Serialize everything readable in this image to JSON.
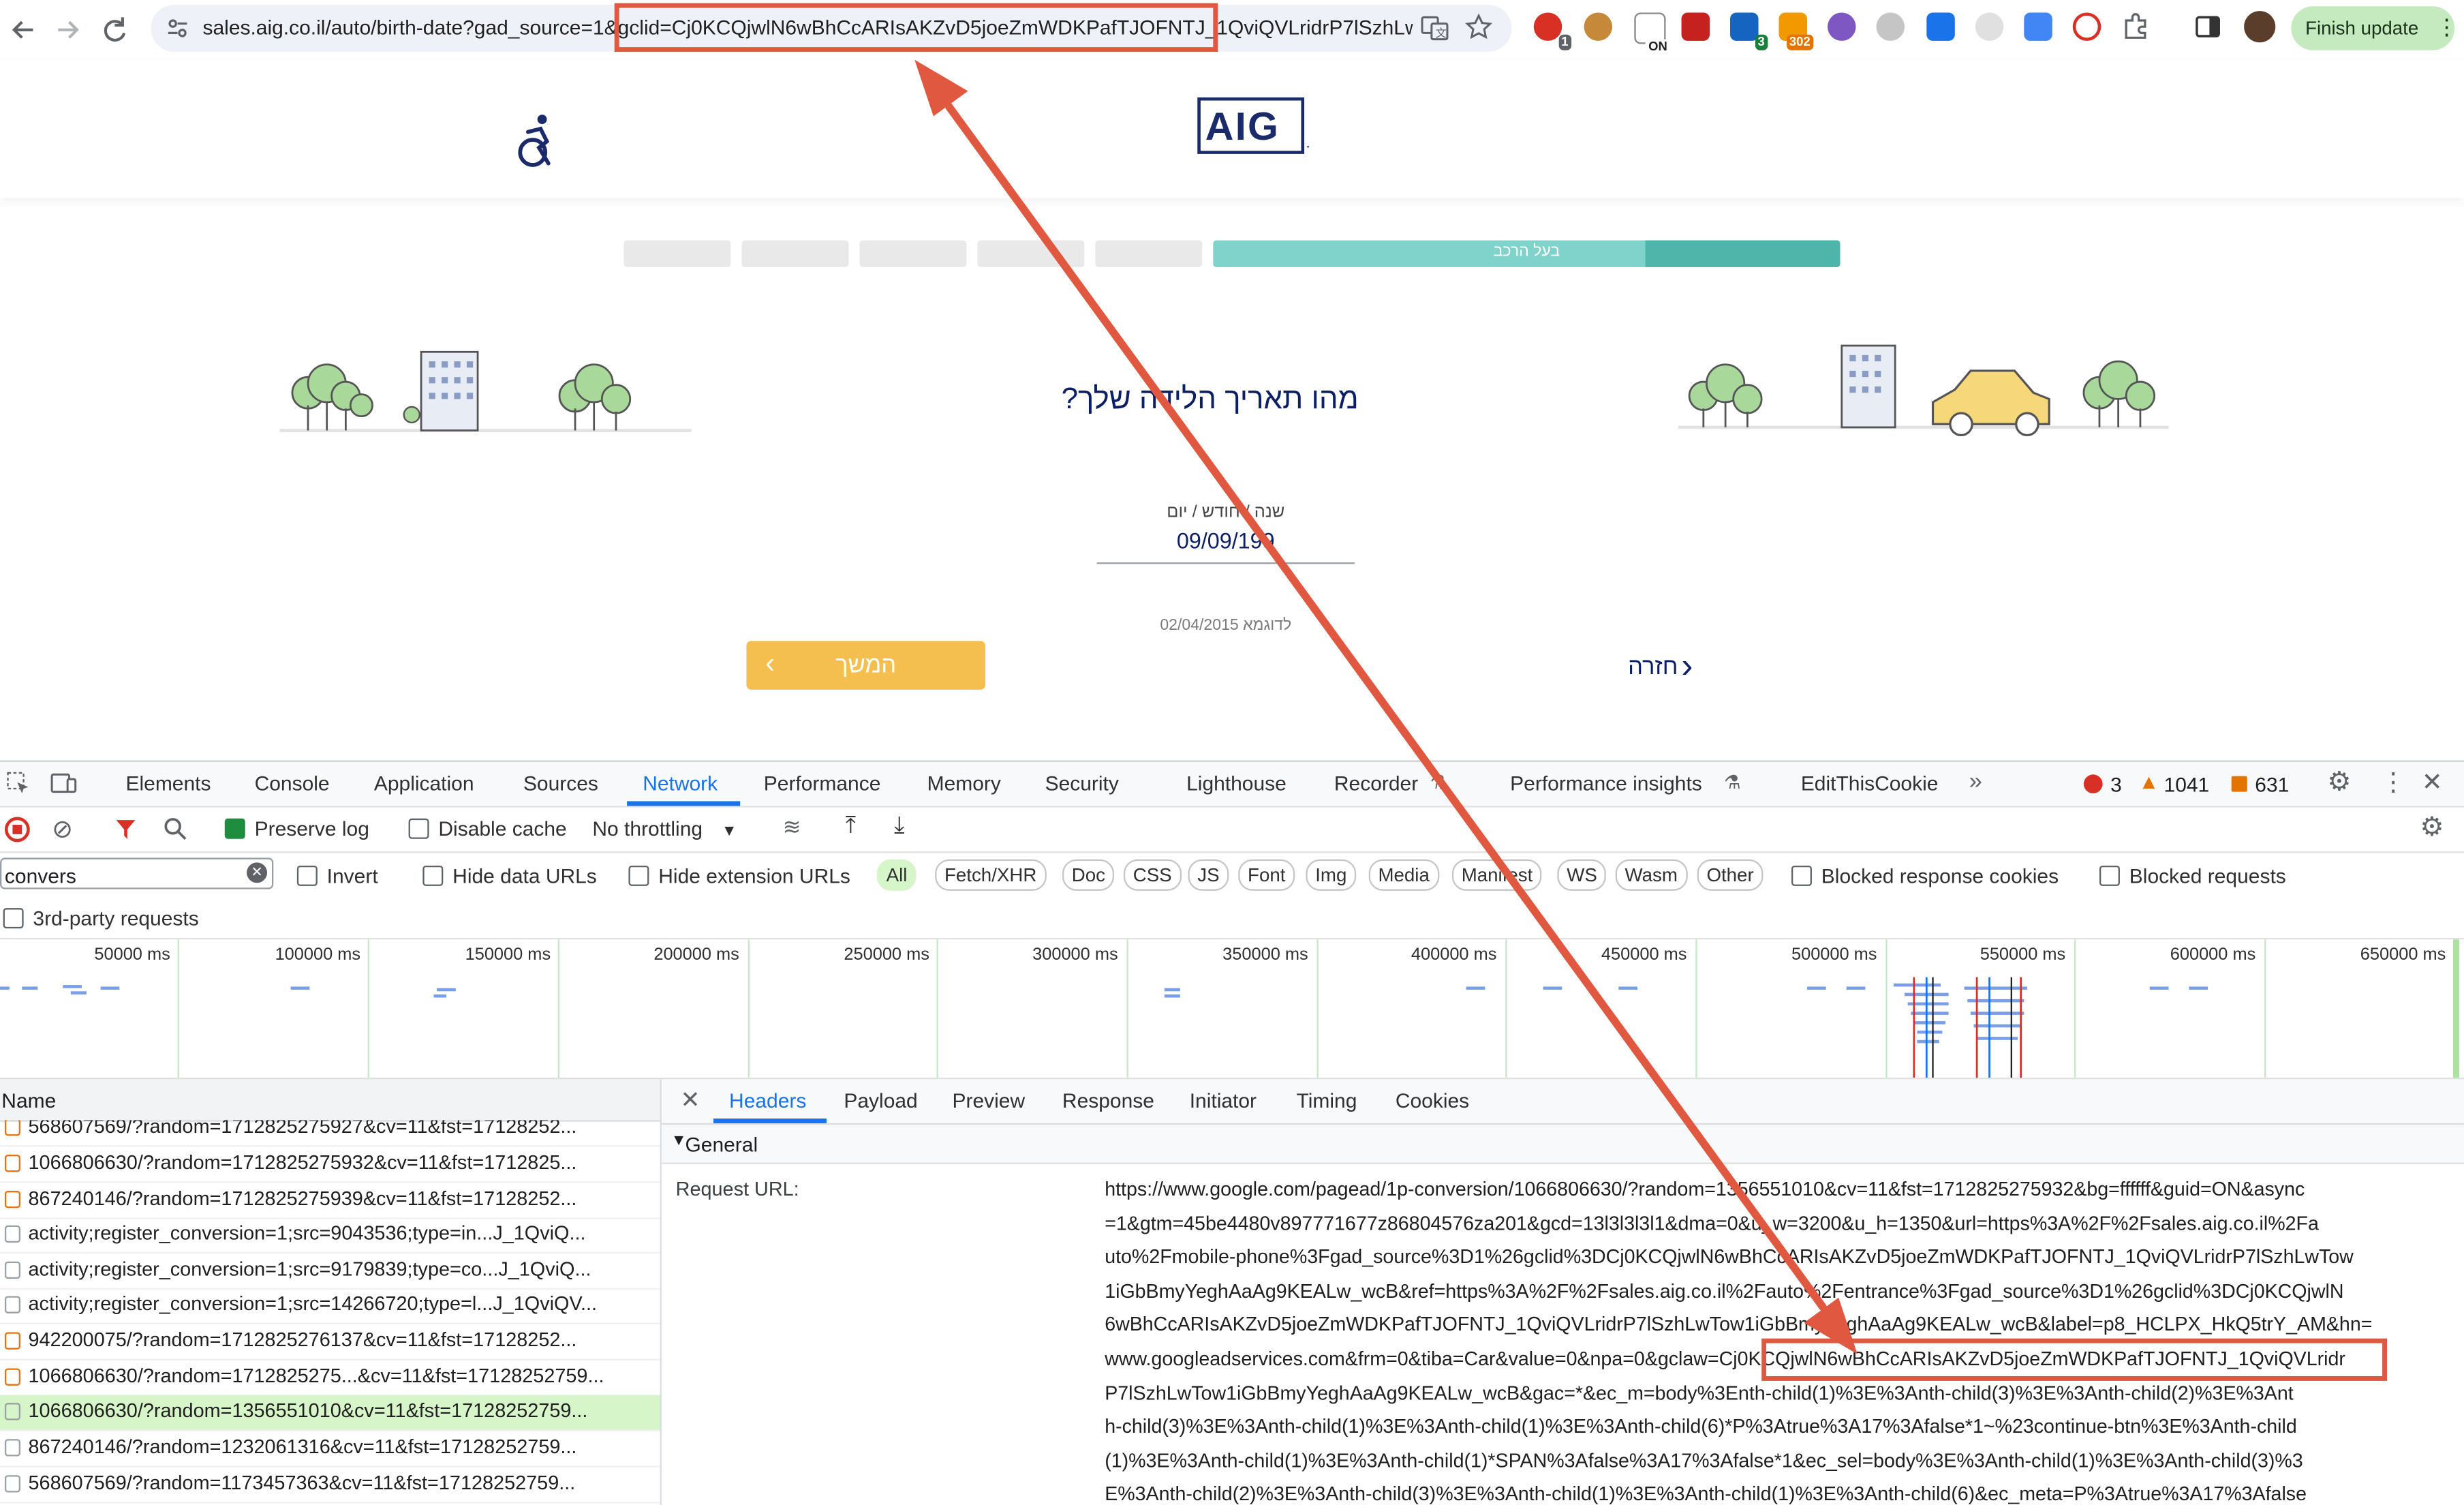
{
  "browser": {
    "url": "sales.aig.co.il/auto/birth-date?gad_source=1&gclid=Cj0KCQjwlN6wBhCcARIsAKZvD5joeZmWDKPafTJOFNTJ_1QviQVLridrP7lSzhLwT...",
    "finish_update_label": "Finish update",
    "ext_badges": [
      "1",
      "ON",
      "3",
      "302"
    ]
  },
  "page": {
    "logo_text": "AIG",
    "logo_mark": ".",
    "progress_label": "בעל הרכב",
    "question": "מהו תאריך הלידה שלך?",
    "field_label": "שנה / חודש / יום",
    "date_value": "09/09/199",
    "example": "לדוגמא 02/04/2015",
    "continue_label": "המשך",
    "back_label": "חזרה"
  },
  "devtools": {
    "tabs": [
      "Elements",
      "Console",
      "Application",
      "Sources",
      "Network",
      "Performance",
      "Memory",
      "Security",
      "Lighthouse",
      "Recorder",
      "Performance insights",
      "EditThisCookie"
    ],
    "active_tab": "Network",
    "errors": "3",
    "warnings": "1041",
    "issues": "631",
    "toolbar": {
      "preserve_log": "Preserve log",
      "disable_cache": "Disable cache",
      "throttling": "No throttling"
    },
    "filter": {
      "value": "convers",
      "invert": "Invert",
      "hide_data_urls": "Hide data URLs",
      "hide_extension_urls": "Hide extension URLs",
      "types": [
        "All",
        "Fetch/XHR",
        "Doc",
        "CSS",
        "JS",
        "Font",
        "Img",
        "Media",
        "Manifest",
        "WS",
        "Wasm",
        "Other"
      ],
      "blocked_cookies": "Blocked response cookies",
      "blocked_requests": "Blocked requests",
      "third_party": "3rd-party requests"
    },
    "timeline_ticks": [
      "50000 ms",
      "100000 ms",
      "150000 ms",
      "200000 ms",
      "250000 ms",
      "300000 ms",
      "350000 ms",
      "400000 ms",
      "450000 ms",
      "500000 ms",
      "550000 ms",
      "600000 ms",
      "650000 ms"
    ],
    "name_header": "Name",
    "requests": [
      {
        "name": "568607569/?random=1712825275927&cv=11&fst=17128252...",
        "type": "script"
      },
      {
        "name": "1066806630/?random=1712825275932&cv=11&fst=1712825...",
        "type": "script"
      },
      {
        "name": "867240146/?random=1712825275939&cv=11&fst=17128252...",
        "type": "script"
      },
      {
        "name": "activity;register_conversion=1;src=9043536;type=in...J_1QviQ...",
        "type": "doc"
      },
      {
        "name": "activity;register_conversion=1;src=9179839;type=co...J_1QviQ...",
        "type": "doc"
      },
      {
        "name": "activity;register_conversion=1;src=14266720;type=l...J_1QviQV...",
        "type": "doc"
      },
      {
        "name": "942200075/?random=1712825276137&cv=11&fst=17128252...",
        "type": "script"
      },
      {
        "name": "1066806630/?random=1712825275...&cv=11&fst=17128252759...",
        "type": "script"
      },
      {
        "name": "1066806630/?random=1356551010&cv=11&fst=17128252759...",
        "type": "doc",
        "selected": true
      },
      {
        "name": "867240146/?random=1232061316&cv=11&fst=17128252759...",
        "type": "doc"
      },
      {
        "name": "568607569/?random=1173457363&cv=11&fst=17128252759...",
        "type": "doc"
      }
    ],
    "detail_tabs": [
      "Headers",
      "Payload",
      "Preview",
      "Response",
      "Initiator",
      "Timing",
      "Cookies"
    ],
    "active_detail_tab": "Headers",
    "general_label": "General",
    "request_url_label": "Request URL:",
    "request_url_lines": [
      "https://www.google.com/pagead/1p-conversion/1066806630/?random=1356551010&cv=11&fst=1712825275932&bg=ffffff&guid=ON&async",
      "=1&gtm=45be4480v897771677z86804576za201&gcd=13l3l3l3l1&dma=0&u_w=3200&u_h=1350&url=https%3A%2F%2Fsales.aig.co.il%2Fa",
      "uto%2Fmobile-phone%3Fgad_source%3D1%26gclid%3DCj0KCQjwlN6wBhCcARIsAKZvD5joeZmWDKPafTJOFNTJ_1QviQVLridrP7lSzhLwTow",
      "1iGbBmyYeghAaAg9KEALw_wcB&ref=https%3A%2F%2Fsales.aig.co.il%2Fauto%2Fentrance%3Fgad_source%3D1%26gclid%3DCj0KCQjwlN",
      "6wBhCcARIsAKZvD5joeZmWDKPafTJOFNTJ_1QviQVLridrP7lSzhLwTow1iGbBmyYeghAaAg9KEALw_wcB&label=p8_HCLPX_HkQ5trY_AM&hn=",
      "www.googleadservices.com&frm=0&tiba=Car&value=0&npa=0&gclaw=Cj0KCQjwlN6wBhCcARIsAKZvD5joeZmWDKPafTJOFNTJ_1QviQVLridr",
      "P7lSzhLwTow1iGbBmyYeghAaAg9KEALw_wcB&gac=*&ec_m=body%3Enth-child(1)%3E%3Anth-child(3)%3E%3Anth-child(2)%3E%3Ant",
      "h-child(3)%3E%3Anth-child(1)%3E%3Anth-child(1)%3E%3Anth-child(6)*P%3Atrue%3A17%3Afalse*1~%23continue-btn%3E%3Anth-child",
      "(1)%3E%3Anth-child(1)%3E%3Anth-child(1)*SPAN%3Afalse%3A17%3Afalse*1&ec_sel=body%3E%3Anth-child(1)%3E%3Anth-child(3)%3",
      "E%3Anth-child(2)%3E%3Anth-child(3)%3E%3Anth-child(1)%3E%3Anth-child(1)%3E%3Anth-child(6)&ec_meta=P%3Atrue%3A17%3Afalse"
    ]
  },
  "colors": {
    "annotation": "#e0583f",
    "aig_navy": "#1b2a6b",
    "progress_teal": "#7fd3cb",
    "button_yellow": "#f4bf4f",
    "devtools_accent": "#1a73e8",
    "selected_row": "#d6f5c8"
  }
}
